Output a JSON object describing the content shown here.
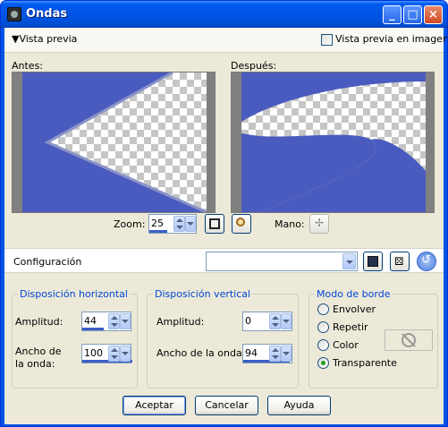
{
  "window": {
    "title": "Ondas"
  },
  "preview_bar": {
    "toggle_label": "Vista previa",
    "image_preview_label": "Vista previa en imagen",
    "image_preview_checked": false
  },
  "before": {
    "label": "Antes:"
  },
  "after": {
    "label": "Después:"
  },
  "zoom": {
    "label": "Zoom:",
    "value": "25"
  },
  "hand": {
    "label": "Mano:"
  },
  "config": {
    "label": "Configuración",
    "selected": ""
  },
  "horizontal": {
    "title": "Disposición horizontal",
    "amplitude_label": "Amplitud:",
    "amplitude_value": "44",
    "wavelength_label": "Ancho de la onda:",
    "wavelength_value": "100"
  },
  "vertical": {
    "title": "Disposición vertical",
    "amplitude_label": "Amplitud:",
    "amplitude_value": "0",
    "wavelength_label": "Ancho de la onda:",
    "wavelength_value": "94"
  },
  "edge_mode": {
    "title": "Modo de borde",
    "options": [
      "Envolver",
      "Repetir",
      "Color",
      "Transparente"
    ],
    "selected": "Transparente"
  },
  "buttons": {
    "ok": "Aceptar",
    "cancel": "Cancelar",
    "help": "Ayuda"
  },
  "colors": {
    "wave_blue": "#4a5bbf",
    "title_blue": "#0054e3",
    "group_title": "#0046d5"
  }
}
